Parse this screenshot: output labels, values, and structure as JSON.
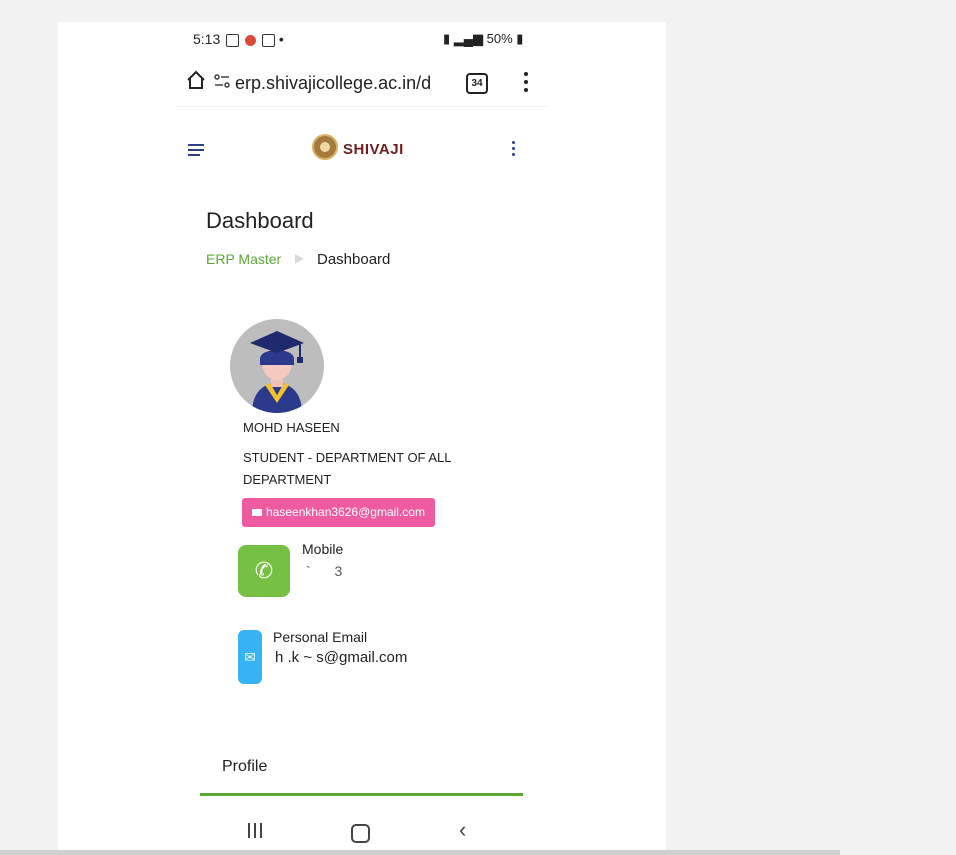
{
  "status_bar": {
    "time": "5:13",
    "right": "50%"
  },
  "browser": {
    "url": "erp.shivajicollege.ac.in/d",
    "tab_count": "34"
  },
  "app": {
    "logo_text": "SHIVAJI"
  },
  "page": {
    "title": "Dashboard",
    "breadcrumb": [
      "ERP Master",
      "Dashboard"
    ]
  },
  "profile": {
    "name": "MOHD HASEEN",
    "role": "STUDENT - DEPARTMENT OF ALL DEPARTMENT",
    "email": "haseenkhan3626@gmail.com",
    "mobile_label": "Mobile",
    "mobile_value": "` 3",
    "personal_email_label": "Personal Email",
    "personal_email_value": "h   .k   ~  s@gmail.com"
  },
  "tabs": {
    "active": "Profile"
  },
  "colors": {
    "accent_green": "#5aa832",
    "badge_pink": "#ef5ba1",
    "phone_green": "#76c043",
    "mail_blue": "#35b3f4"
  }
}
